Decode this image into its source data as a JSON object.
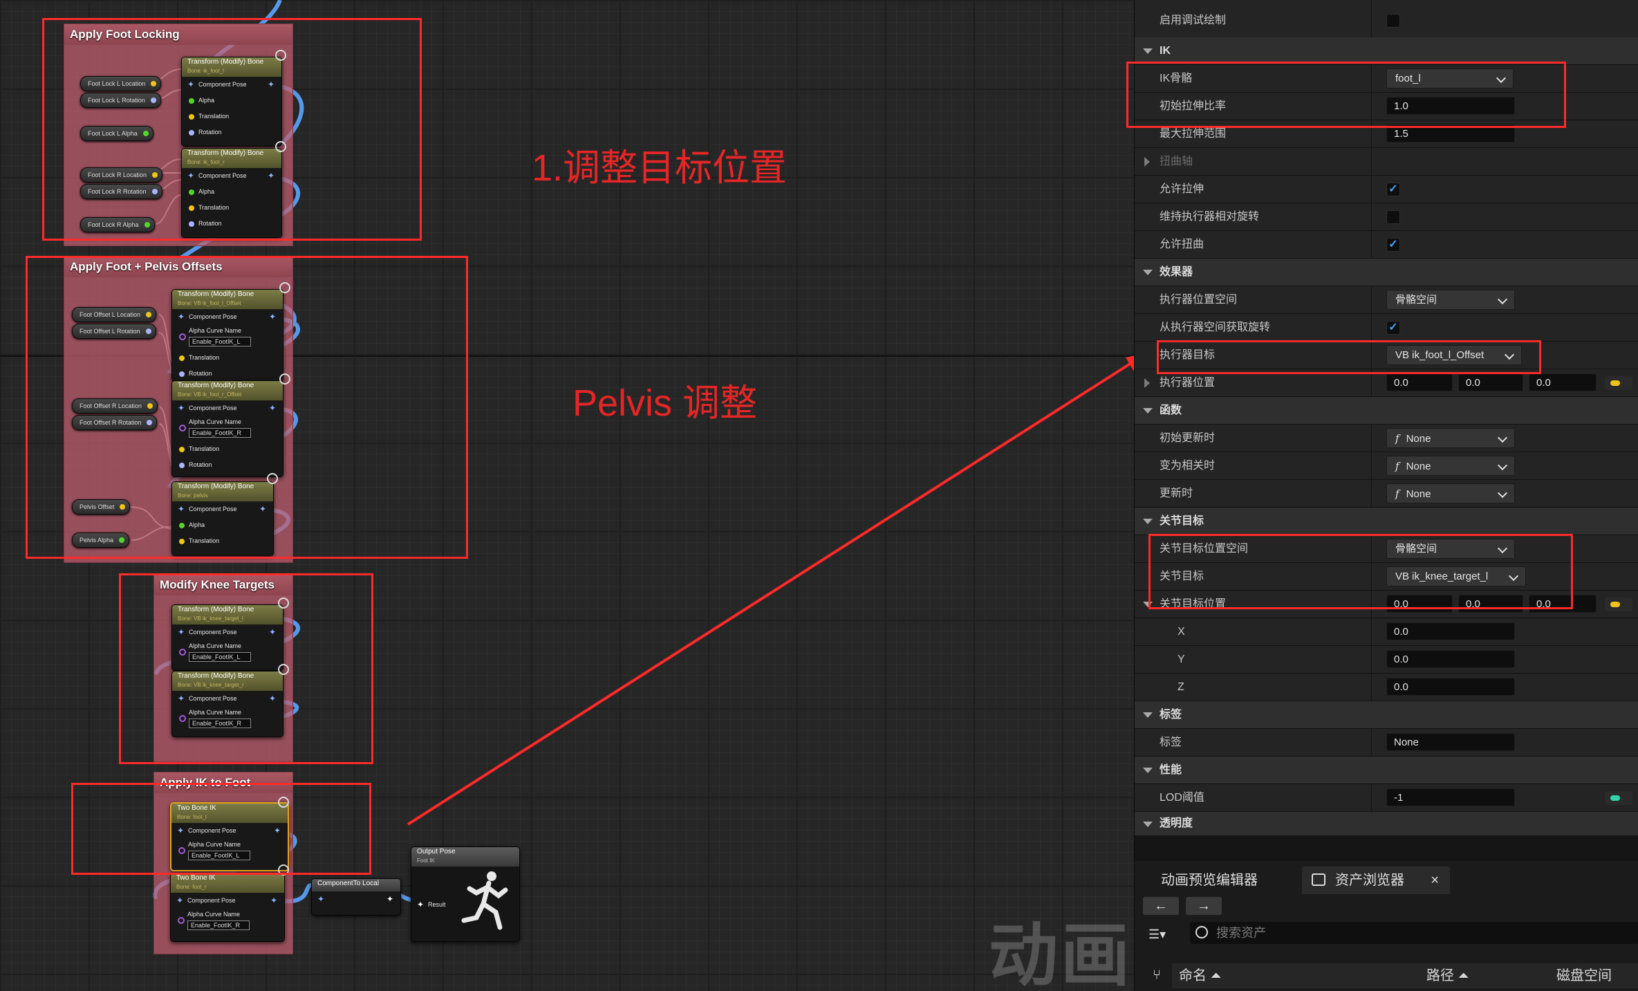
{
  "graph": {
    "groups": {
      "foot_locking": "Apply Foot Locking",
      "offsets": "Apply Foot + Pelvis Offsets",
      "knee": "Modify Knee Targets",
      "ik": "Apply IK to Foot"
    },
    "nodes": {
      "tm_title": "Transform (Modify) Bone",
      "two_bone_title": "Two Bone IK",
      "bone_foot_l": "Bone: ik_foot_l",
      "bone_foot_r": "Bone: ik_foot_r",
      "bone_vb_foot_l_offset": "Bone: VB ik_foot_l_Offset",
      "bone_vb_foot_r_offset": "Bone: VB ik_foot_r_Offset",
      "bone_pelvis": "Bone: pelvis",
      "bone_vb_knee_l": "Bone: VB ik_knee_target_l",
      "bone_vb_knee_r": "Bone: VB ik_knee_target_r",
      "bone_ik_foot_l": "Bone: foot_l",
      "bone_ik_foot_r": "Bone: foot_r",
      "pin_component_pose": "Component Pose",
      "pin_alpha": "Alpha",
      "pin_translation": "Translation",
      "pin_rotation": "Rotation",
      "pin_alpha_curve": "Alpha Curve Name",
      "curve_l": "Enable_FootIK_L",
      "curve_r": "Enable_FootIK_R",
      "component_to_local": "ComponentTo Local",
      "output_pose": "Output Pose",
      "output_sub": "Foot IK",
      "result": "Result"
    },
    "vars": {
      "lock_l_loc": "Foot Lock L Location",
      "lock_l_rot": "Foot Lock L Rotation",
      "lock_l_alpha": "Foot Lock L Alpha",
      "lock_r_loc": "Foot Lock R Location",
      "lock_r_rot": "Foot Lock R Rotation",
      "lock_r_alpha": "Foot Lock R Alpha",
      "off_l_loc": "Foot Offset L Location",
      "off_l_rot": "Foot Offset L Rotation",
      "off_r_loc": "Foot Offset R Location",
      "off_r_rot": "Foot Offset R Rotation",
      "pelvis_off": "Pelvis Offset",
      "pelvis_alpha": "Pelvis Alpha"
    },
    "annotations": {
      "note1": "1.调整目标位置",
      "note2": "Pelvis 调整"
    },
    "watermark": "动画"
  },
  "details": {
    "rows": {
      "debug_draw": "启用调试绘制",
      "ik_section": "IK",
      "ik_bone": "IK骨骼",
      "ik_bone_val": "foot_l",
      "start_stretch": "初始拉伸比率",
      "start_stretch_val": "1.0",
      "max_stretch": "最大拉伸范围",
      "max_stretch_val": "1.5",
      "twist_axis": "扭曲轴",
      "allow_stretch": "允许拉伸",
      "keep_rel_rot": "维持执行器相对旋转",
      "allow_twist": "允许扭曲",
      "effector_section": "效果器",
      "eff_space": "执行器位置空间",
      "eff_space_val": "骨骼空间",
      "eff_take_rot": "从执行器空间获取旋转",
      "eff_target": "执行器目标",
      "eff_target_val": "VB ik_foot_l_Offset",
      "eff_loc": "执行器位置",
      "func_section": "函数",
      "init_update": "初始更新时",
      "become_rel": "变为相关时",
      "on_update": "更新时",
      "none": "None",
      "joint_section": "关节目标",
      "joint_space": "关节目标位置空间",
      "joint_space_val": "骨骼空间",
      "joint_target": "关节目标",
      "joint_target_val": "VB ik_knee_target_l",
      "joint_loc": "关节目标位置",
      "x": "X",
      "y": "Y",
      "z": "Z",
      "zero": "0.0",
      "tag_section": "标签",
      "tag": "标签",
      "tag_val": "None",
      "perf_section": "性能",
      "lod": "LOD阈值",
      "lod_val": "-1",
      "alpha_section": "透明度"
    },
    "check_mark": "✓"
  },
  "bottom": {
    "tab_anim": "动画预览编辑器",
    "tab_assets": "资产浏览器",
    "close": "×",
    "back": "←",
    "forward": "→",
    "search_placeholder": "搜索资产",
    "col_name": "命名",
    "col_path": "路径",
    "col_disk": "磁盘空间"
  },
  "colors": {
    "annotation_red": "#ff2a2a",
    "checkbox_blue": "#4aa3ff",
    "wire_blue": "#5da6ff",
    "group_tint": "#c46070"
  }
}
